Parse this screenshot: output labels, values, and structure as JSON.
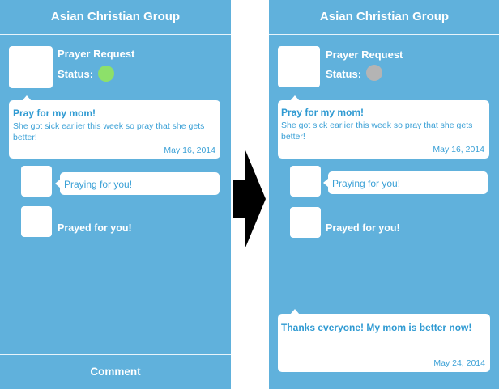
{
  "left_screen": {
    "header_title": "Asian Christian Group",
    "post_title": "Prayer Request",
    "status_label": "Status:",
    "status_color": "#8de06a",
    "request": {
      "title": "Pray for my mom!",
      "body": "She got sick earlier this week so pray that she gets better!",
      "date": "May 16, 2014"
    },
    "reply_text": "Praying for you!",
    "prayed_text": "Prayed for you!",
    "comment_label": "Comment"
  },
  "right_screen": {
    "header_title": "Asian Christian Group",
    "post_title": "Prayer Request",
    "status_label": "Status:",
    "status_color": "#b4b4b4",
    "request": {
      "title": "Pray for my mom!",
      "body": "She got sick earlier this week so pray that she gets better!",
      "date": "May 16, 2014"
    },
    "reply_text": "Praying for you!",
    "prayed_text": "Prayed for you!",
    "update": {
      "title": "Thanks everyone! My mom is better now!",
      "date": "May 24, 2014"
    }
  },
  "colors": {
    "app_background": "#60b1dc",
    "accent_text": "#2f9ad2"
  },
  "icons": {
    "transition": "arrow-right-icon"
  }
}
